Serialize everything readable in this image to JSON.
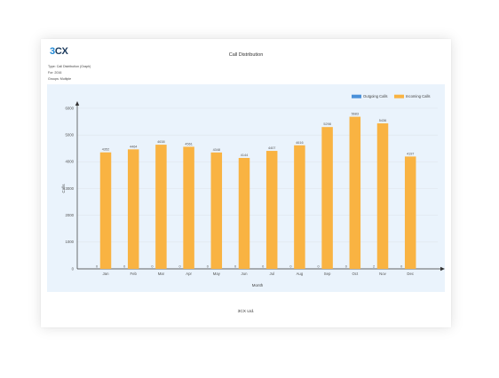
{
  "report": {
    "logo_text": "3CX",
    "title": "Call Distribution",
    "meta_lines": [
      "Type: Call Distribution (Graph)",
      "For: 2016",
      "Groups: Multiple"
    ],
    "footer": "3CX Ltd."
  },
  "chart_data": {
    "type": "bar",
    "categories": [
      "Jan",
      "Feb",
      "Mar",
      "Apr",
      "May",
      "Jun",
      "Jul",
      "Aug",
      "Sep",
      "Oct",
      "Nov",
      "Dec"
    ],
    "series": [
      {
        "name": "Outgoing Calls",
        "color": "#4a90d9",
        "values": [
          0,
          0,
          0,
          0,
          0,
          0,
          0,
          0,
          0,
          0,
          2,
          0
        ]
      },
      {
        "name": "Incoming Calls",
        "color": "#f9b342",
        "values": [
          4352,
          4464,
          4638,
          4561,
          4348,
          4144,
          4407,
          4616,
          5298,
          5683,
          5436,
          4197
        ]
      }
    ],
    "xlabel": "Month",
    "ylabel": "Calls",
    "ylim": [
      0,
      6000
    ],
    "yticks": [
      0,
      1000,
      2000,
      3000,
      4000,
      5000,
      6000
    ],
    "grid": true,
    "legend_position": "top-right"
  }
}
